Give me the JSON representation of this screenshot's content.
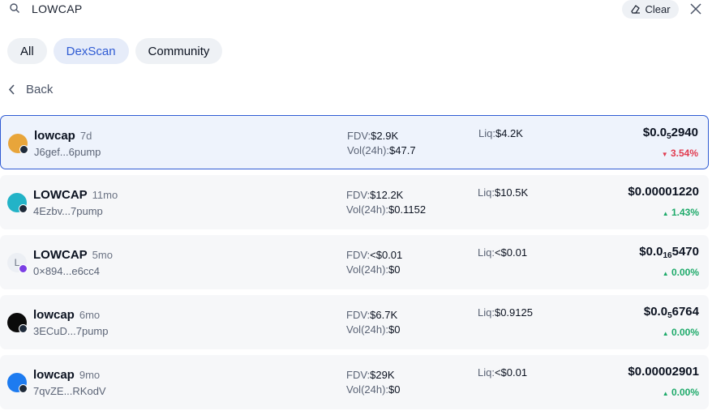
{
  "search": {
    "query": "LOWCAP",
    "clear_label": "Clear"
  },
  "tabs": [
    {
      "label": "All",
      "active": false
    },
    {
      "label": "DexScan",
      "active": true
    },
    {
      "label": "Community",
      "active": false
    }
  ],
  "back_label": "Back",
  "labels": {
    "fdv": "FDV:",
    "vol": "Vol(24h):",
    "liq": "Liq:"
  },
  "tokens": [
    {
      "name": "lowcap",
      "age": "7d",
      "address": "J6gef...6pump",
      "fdv": "$2.9K",
      "vol": "$47.7",
      "liq": "$4.2K",
      "price_prefix": "$0.0",
      "price_sub": "5",
      "price_rest": "2940",
      "change": "3.54%",
      "direction": "down",
      "avatar_color": "#e8a53a",
      "badge_color": "#1e2a3a",
      "selected": true,
      "avatar_icon": "lowcap-logo-icon"
    },
    {
      "name": "LOWCAP",
      "age": "11mo",
      "address": "4Ezbv...7pump",
      "fdv": "$12.2K",
      "vol": "$0.1152",
      "liq": "$10.5K",
      "price_prefix": "$0.00001220",
      "price_sub": "",
      "price_rest": "",
      "change": "1.43%",
      "direction": "up",
      "avatar_color": "#23b3c7",
      "badge_color": "#1e2a3a",
      "selected": false,
      "avatar_icon": "diamond-icon"
    },
    {
      "name": "LOWCAP",
      "age": "5mo",
      "address": "0×894...e6cc4",
      "fdv": "<$0.01",
      "vol": "$0",
      "liq": "<$0.01",
      "price_prefix": "$0.0",
      "price_sub": "16",
      "price_rest": "5470",
      "change": "0.00%",
      "direction": "up",
      "avatar_color": "#eceff4",
      "badge_color": "#7b3fe4",
      "selected": false,
      "avatar_icon": "letter-l-icon"
    },
    {
      "name": "lowcap",
      "age": "6mo",
      "address": "3ECuD...7pump",
      "fdv": "$6.7K",
      "vol": "$0",
      "liq": "$0.9125",
      "price_prefix": "$0.0",
      "price_sub": "5",
      "price_rest": "6764",
      "change": "0.00%",
      "direction": "up",
      "avatar_color": "#0b0b0b",
      "badge_color": "#1e2a3a",
      "selected": false,
      "avatar_icon": "black-circle-icon"
    },
    {
      "name": "lowcap",
      "age": "9mo",
      "address": "7qvZE...RKodV",
      "fdv": "$29K",
      "vol": "$0",
      "liq": "<$0.01",
      "price_prefix": "$0.00002901",
      "price_sub": "",
      "price_rest": "",
      "change": "0.00%",
      "direction": "up",
      "avatar_color": "#1d7bf0",
      "badge_color": "#1e2a3a",
      "selected": false,
      "avatar_icon": "blue-circle-icon"
    }
  ]
}
